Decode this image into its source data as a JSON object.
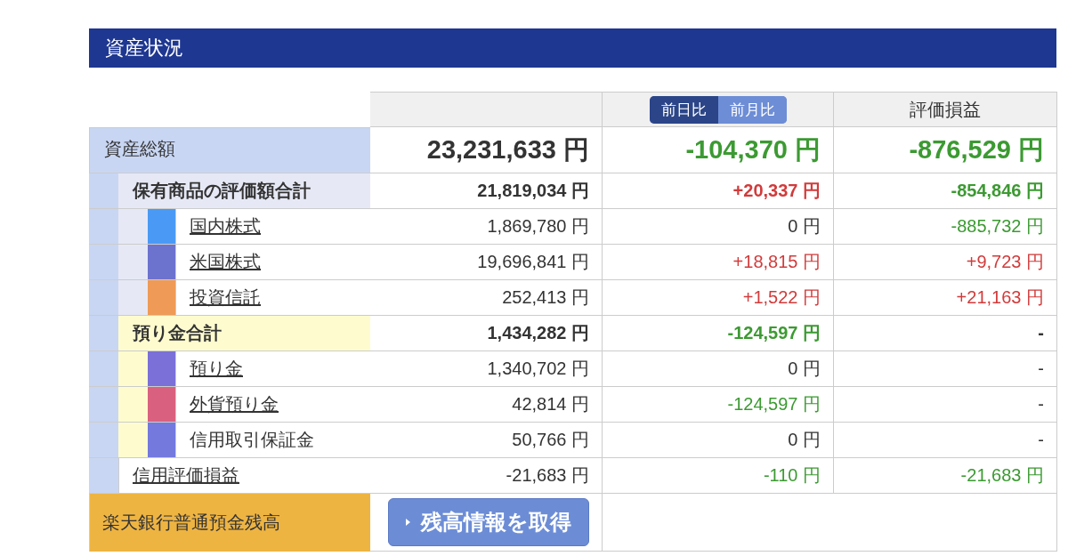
{
  "title": "資産状況",
  "header": {
    "toggle": [
      {
        "label": "前日比",
        "selected": true
      },
      {
        "label": "前月比",
        "selected": false
      }
    ],
    "column_4": "評価損益"
  },
  "total": {
    "label": "資産総額",
    "value": "23,231,633 円",
    "change": {
      "text": "-104,370 円",
      "color": "#3c9a32"
    },
    "pnl": {
      "text": "-876,529 円",
      "color": "#3c9a32"
    }
  },
  "groups": [
    {
      "kind": "holdings",
      "label": "保有商品の評価額合計",
      "value": "21,819,034 円",
      "change": {
        "text": "+20,337 円",
        "color": "#d23b3b"
      },
      "pnl": {
        "text": "-854,846 円",
        "color": "#3c9a32"
      },
      "items": [
        {
          "label": "国内株式",
          "link": true,
          "color": "#4a9af5",
          "value": "1,869,780 円",
          "change": {
            "text": "0 円",
            "color": "#333333"
          },
          "pnl": {
            "text": "-885,732 円",
            "color": "#3c9a32"
          }
        },
        {
          "label": "米国株式",
          "link": true,
          "color": "#6c73cf",
          "value": "19,696,841 円",
          "change": {
            "text": "+18,815 円",
            "color": "#d23b3b"
          },
          "pnl": {
            "text": "+9,723 円",
            "color": "#d23b3b"
          }
        },
        {
          "label": "投資信託",
          "link": true,
          "color": "#ef9a56",
          "value": "252,413 円",
          "change": {
            "text": "+1,522 円",
            "color": "#d23b3b"
          },
          "pnl": {
            "text": "+21,163 円",
            "color": "#d23b3b"
          }
        }
      ]
    },
    {
      "kind": "deposits",
      "label": "預り金合計",
      "value": "1,434,282 円",
      "change": {
        "text": "-124,597 円",
        "color": "#3c9a32"
      },
      "pnl": {
        "text": "-",
        "color": "#333333"
      },
      "items": [
        {
          "label": "預り金",
          "link": true,
          "color": "#7b6fd8",
          "value": "1,340,702 円",
          "change": {
            "text": "0 円",
            "color": "#333333"
          },
          "pnl": {
            "text": "-",
            "color": "#333333"
          }
        },
        {
          "label": "外貨預り金",
          "link": true,
          "color": "#d9617f",
          "value": "42,814 円",
          "change": {
            "text": "-124,597 円",
            "color": "#3c9a32"
          },
          "pnl": {
            "text": "-",
            "color": "#333333"
          }
        },
        {
          "label": "信用取引保証金",
          "link": false,
          "color": "#7479de",
          "value": "50,766 円",
          "change": {
            "text": "0 円",
            "color": "#333333"
          },
          "pnl": {
            "text": "-",
            "color": "#333333"
          }
        }
      ]
    }
  ],
  "margin": {
    "label": "信用評価損益",
    "link": true,
    "value": "-21,683 円",
    "change": {
      "text": "-110 円",
      "color": "#3c9a32"
    },
    "pnl": {
      "text": "-21,683 円",
      "color": "#3c9a32"
    }
  },
  "bank": {
    "label": "楽天銀行普通預金残高",
    "button": "残高情報を取得"
  }
}
